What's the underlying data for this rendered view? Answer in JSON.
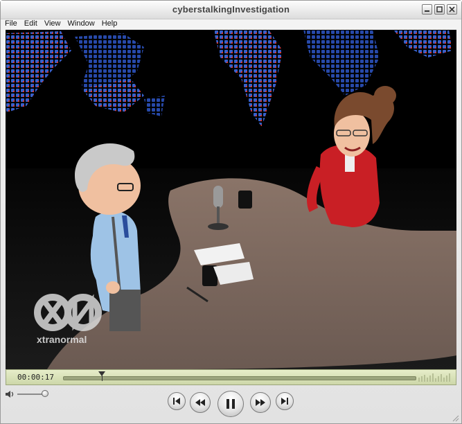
{
  "window": {
    "title": "cyberstalkingInvestigation"
  },
  "menu": {
    "items": [
      "File",
      "Edit",
      "View",
      "Window",
      "Help"
    ]
  },
  "video": {
    "watermark": "xtranormal"
  },
  "status": {
    "time": "00:00:17",
    "progress": 0.11
  },
  "volume": {
    "level": 0.9
  },
  "icons": {
    "minimize": "minimize-icon",
    "maximize": "maximize-icon",
    "close": "close-icon",
    "speaker": "speaker-icon",
    "prev": "skip-back-icon",
    "rewind": "rewind-icon",
    "pause": "pause-icon",
    "forward": "fast-forward-icon",
    "next": "skip-forward-icon"
  },
  "colors": {
    "status_bg": "#dfe6c0",
    "accent": "#c0161a"
  }
}
